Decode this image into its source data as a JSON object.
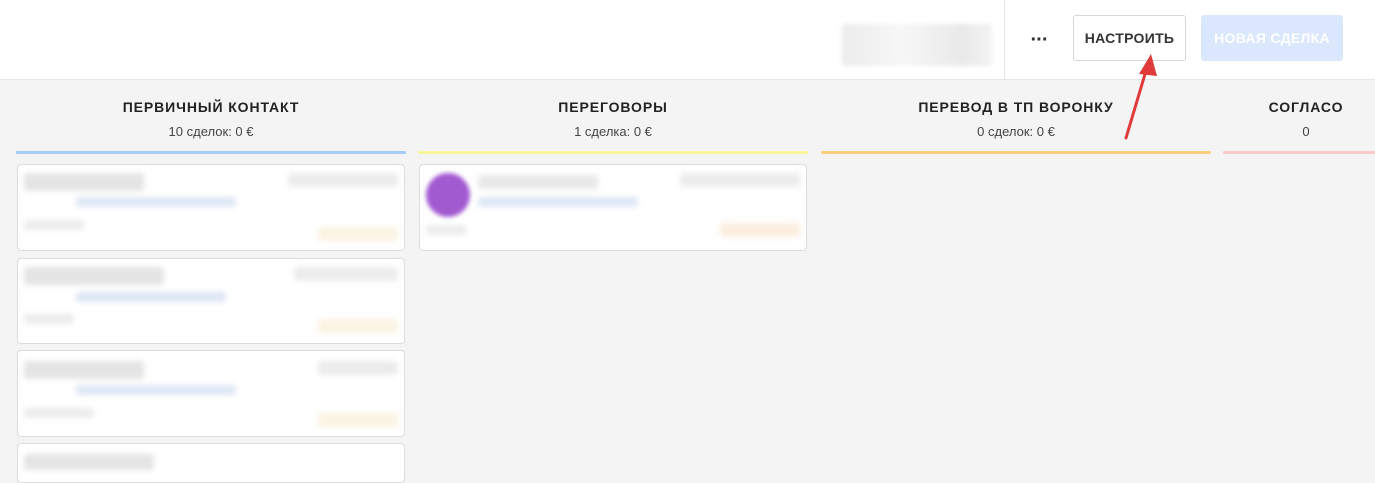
{
  "header": {
    "more_label": "···",
    "settings_label": "НАСТРОИТЬ",
    "new_deal_label": "НОВАЯ СДЕЛКА"
  },
  "columns": [
    {
      "title": "ПЕРВИЧНЫЙ КОНТАКТ",
      "summary": "10 сделок: 0 €",
      "color": "#a7cdfb"
    },
    {
      "title": "ПЕРЕГОВОРЫ",
      "summary": "1 сделка: 0 €",
      "color": "#f7f79a"
    },
    {
      "title": "ПЕРЕВОД В ТП ВОРОНКУ",
      "summary": "0 сделок: 0 €",
      "color": "#fbcf7e"
    },
    {
      "title": "СОГЛАСО",
      "summary": "0",
      "color": "#f9c9c9"
    }
  ],
  "colors": {
    "accent_arrow": "#e03a3a",
    "new_deal_bg": "#dbe7fd",
    "avatar": "#a25ad0"
  }
}
